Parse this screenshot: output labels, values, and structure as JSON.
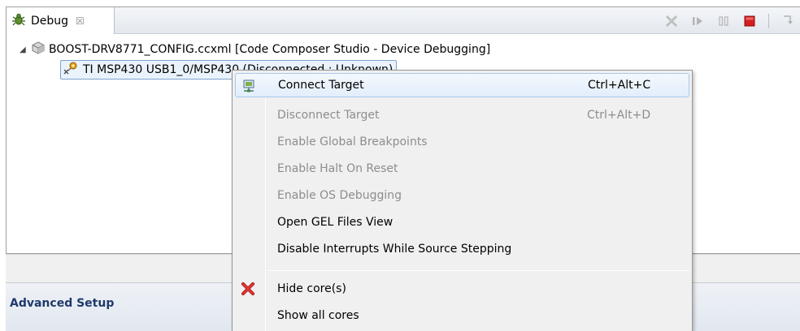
{
  "debug_view": {
    "tab": {
      "label": "Debug",
      "icon": "debug-bug-icon",
      "close_glyph": "☒"
    },
    "toolbar": {
      "buttons": [
        {
          "name": "remove-terminated-icon"
        },
        {
          "name": "resume-icon"
        },
        {
          "name": "suspend-icon"
        },
        {
          "name": "terminate-icon",
          "color": "#d42020"
        },
        {
          "name": "step-into-icon"
        }
      ]
    },
    "tree": {
      "root": {
        "label": "BOOST-DRV8771_CONFIG.ccxml [Code Composer Studio - Device Debugging]",
        "expander": "◢"
      },
      "child": {
        "label": "TI MSP430 USB1_0/MSP430 (Disconnected : Unknown)"
      }
    }
  },
  "advanced_setup": {
    "title": "Advanced Setup"
  },
  "context_menu": {
    "items": [
      {
        "id": "connect-target",
        "label": "Connect Target",
        "accel": "Ctrl+Alt+C",
        "icon": "connect-target-icon",
        "enabled": true,
        "highlighted": true
      },
      {
        "id": "disconnect-target",
        "label": "Disconnect Target",
        "accel": "Ctrl+Alt+D",
        "enabled": false
      },
      {
        "id": "enable-global-breakpoints",
        "label": "Enable Global Breakpoints",
        "enabled": false
      },
      {
        "id": "enable-halt-on-reset",
        "label": "Enable Halt On Reset",
        "enabled": false
      },
      {
        "id": "enable-os-debugging",
        "label": "Enable OS Debugging",
        "enabled": false
      },
      {
        "id": "open-gel-files-view",
        "label": "Open GEL Files View",
        "enabled": true
      },
      {
        "id": "disable-interrupts",
        "label": "Disable Interrupts While Source Stepping",
        "enabled": true
      },
      {
        "id": "hide-cores",
        "label": "Hide core(s)",
        "icon": "red-x-icon",
        "enabled": true
      },
      {
        "id": "show-all-cores",
        "label": "Show all cores",
        "enabled": true
      }
    ]
  },
  "colors": {
    "selection_border": "#7da2ce",
    "menu_bg": "#f0f0f0",
    "disabled_text": "#8d8d8d",
    "advanced_title": "#1f3a6a"
  }
}
